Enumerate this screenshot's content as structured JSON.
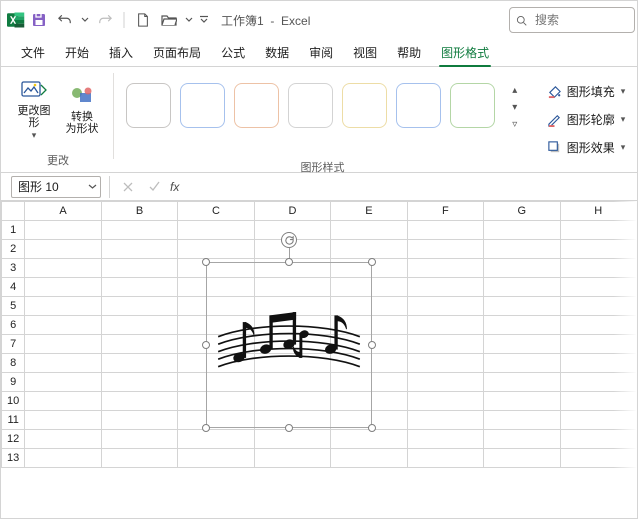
{
  "titlebar": {
    "filename": "工作簿1",
    "appname": "Excel"
  },
  "search": {
    "placeholder": "搜索"
  },
  "tabs": {
    "items": [
      {
        "label": "文件"
      },
      {
        "label": "开始"
      },
      {
        "label": "插入"
      },
      {
        "label": "页面布局"
      },
      {
        "label": "公式"
      },
      {
        "label": "数据"
      },
      {
        "label": "审阅"
      },
      {
        "label": "视图"
      },
      {
        "label": "帮助"
      },
      {
        "label": "图形格式"
      }
    ]
  },
  "ribbon": {
    "group_change": {
      "change_graphic": "更改图\n形",
      "convert_shape": "转换\n为形状",
      "label": "更改"
    },
    "group_styles": {
      "label": "图形样式"
    },
    "group_format": {
      "fill": "图形填充",
      "outline": "图形轮廓",
      "effects": "图形效果"
    }
  },
  "namebox": {
    "value": "图形 10"
  },
  "columns": [
    "A",
    "B",
    "C",
    "D",
    "E",
    "F",
    "G",
    "H"
  ],
  "rows": [
    "1",
    "2",
    "3",
    "4",
    "5",
    "6",
    "7",
    "8",
    "9",
    "10",
    "11",
    "12",
    "13"
  ]
}
